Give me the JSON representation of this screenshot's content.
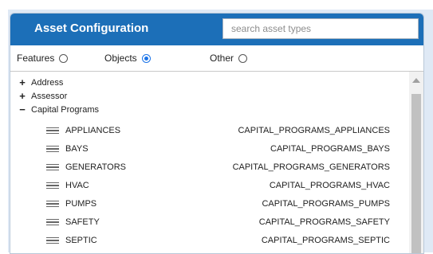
{
  "panel": {
    "title": "Asset Configuration",
    "search": {
      "placeholder": "search asset types",
      "value": ""
    }
  },
  "filters": [
    {
      "label": "Features",
      "checked": false
    },
    {
      "label": "Objects",
      "checked": true
    },
    {
      "label": "Other",
      "checked": false
    }
  ],
  "tree": {
    "groups": [
      {
        "toggle": "+",
        "label": "Address",
        "expanded": false
      },
      {
        "toggle": "+",
        "label": "Assessor",
        "expanded": false
      },
      {
        "toggle": "−",
        "label": "Capital Programs",
        "expanded": true
      }
    ],
    "children": [
      {
        "name": "APPLIANCES",
        "code": "CAPITAL_PROGRAMS_APPLIANCES"
      },
      {
        "name": "BAYS",
        "code": "CAPITAL_PROGRAMS_BAYS"
      },
      {
        "name": "GENERATORS",
        "code": "CAPITAL_PROGRAMS_GENERATORS"
      },
      {
        "name": "HVAC",
        "code": "CAPITAL_PROGRAMS_HVAC"
      },
      {
        "name": "PUMPS",
        "code": "CAPITAL_PROGRAMS_PUMPS"
      },
      {
        "name": "SAFETY",
        "code": "CAPITAL_PROGRAMS_SAFETY"
      },
      {
        "name": "SEPTIC",
        "code": "CAPITAL_PROGRAMS_SEPTIC"
      }
    ]
  },
  "colors": {
    "header": "#1c6fb8",
    "accent": "#1a73e8",
    "background": "#dfe9f5"
  }
}
